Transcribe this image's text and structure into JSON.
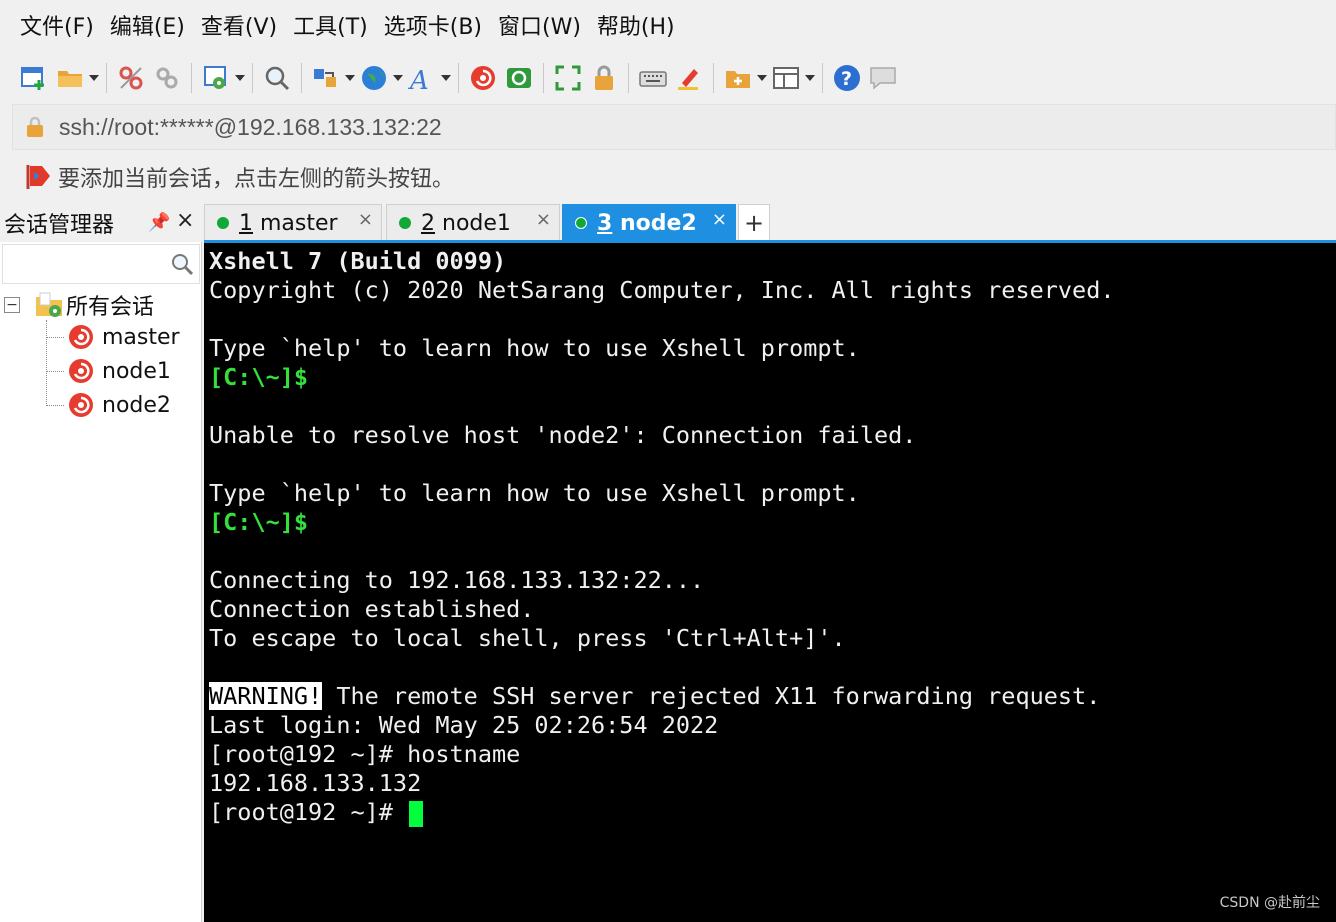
{
  "menu": [
    "文件(F)",
    "编辑(E)",
    "查看(V)",
    "工具(T)",
    "选项卡(B)",
    "窗口(W)",
    "帮助(H)"
  ],
  "toolbar": {
    "icons": [
      "new-session-icon",
      "open-folder-icon",
      "disconnect-icon",
      "reconnect-icon",
      "properties-icon",
      "find-icon",
      "transfer-icon",
      "globe-icon",
      "font-icon",
      "xshell-icon",
      "xftp-icon",
      "fullscreen-icon",
      "lock-icon",
      "keyboard-icon",
      "highlight-icon",
      "add-folder-icon",
      "layout-icon",
      "help-icon",
      "chat-icon"
    ]
  },
  "address": {
    "text": "ssh://root:******@192.168.133.132:22"
  },
  "hint": {
    "text": "要添加当前会话，点击左侧的箭头按钮。"
  },
  "session_manager": {
    "title": "会话管理器",
    "search_placeholder": "",
    "root_label": "所有会话",
    "expander": "−",
    "sessions": [
      "master",
      "node1",
      "node2"
    ]
  },
  "tabs": [
    {
      "num": "1",
      "name": "master",
      "active": false
    },
    {
      "num": "2",
      "name": "node1",
      "active": false
    },
    {
      "num": "3",
      "name": "node2",
      "active": true
    }
  ],
  "tab_add": "+",
  "tab_close": "×",
  "terminal": {
    "lines": [
      {
        "type": "bold",
        "text": "Xshell 7 (Build 0099)"
      },
      {
        "type": "plain",
        "text": "Copyright (c) 2020 NetSarang Computer, Inc. All rights reserved."
      },
      {
        "type": "plain",
        "text": ""
      },
      {
        "type": "plain",
        "text": "Type `help' to learn how to use Xshell prompt."
      },
      {
        "type": "prompt",
        "text": "[C:\\~]$"
      },
      {
        "type": "plain",
        "text": ""
      },
      {
        "type": "plain",
        "text": "Unable to resolve host 'node2': Connection failed."
      },
      {
        "type": "plain",
        "text": ""
      },
      {
        "type": "plain",
        "text": "Type `help' to learn how to use Xshell prompt."
      },
      {
        "type": "prompt",
        "text": "[C:\\~]$"
      },
      {
        "type": "plain",
        "text": ""
      },
      {
        "type": "plain",
        "text": "Connecting to 192.168.133.132:22..."
      },
      {
        "type": "plain",
        "text": "Connection established."
      },
      {
        "type": "plain",
        "text": "To escape to local shell, press 'Ctrl+Alt+]'."
      },
      {
        "type": "plain",
        "text": ""
      },
      {
        "type": "warning",
        "label": "WARNING!",
        "text": " The remote SSH server rejected X11 forwarding request."
      },
      {
        "type": "plain",
        "text": "Last login: Wed May 25 02:26:54 2022"
      },
      {
        "type": "plain",
        "text": "[root@192 ~]# hostname"
      },
      {
        "type": "plain",
        "text": "192.168.133.132"
      },
      {
        "type": "cursor",
        "text": "[root@192 ~]# "
      }
    ]
  },
  "watermark": "CSDN @赴前尘",
  "colors": {
    "accent": "#1e8fe1",
    "status_green": "#12a838",
    "prompt_green": "#33e03c",
    "cursor": "#00ff3c"
  }
}
